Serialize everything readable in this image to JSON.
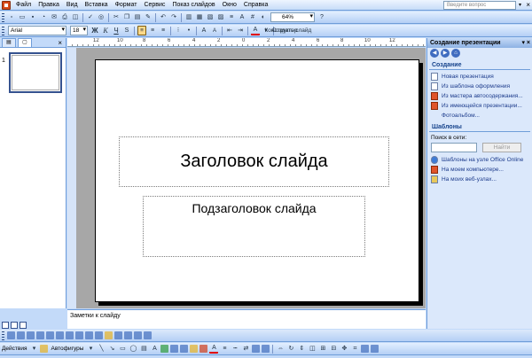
{
  "menu": {
    "items": [
      "Файл",
      "Правка",
      "Вид",
      "Вставка",
      "Формат",
      "Сервис",
      "Показ слайдов",
      "Окно",
      "Справка"
    ],
    "help_placeholder": "Введите вопрос",
    "close": "×"
  },
  "standard_toolbar": {
    "zoom": "64%"
  },
  "format_toolbar": {
    "font": "Arial",
    "size": "18",
    "bold": "Ж",
    "italic": "К",
    "underline": "Ч",
    "shadow": "S",
    "grow_font": "A",
    "shrink_font": "A",
    "font_color": "A",
    "designer": "Конструктор",
    "new_slide": "Создать слайд"
  },
  "left_pane": {
    "close": "×",
    "slide_number": "1"
  },
  "ruler": {
    "labels": [
      "12",
      "10",
      "8",
      "6",
      "4",
      "2",
      "0",
      "2",
      "4",
      "6",
      "8",
      "10",
      "12"
    ]
  },
  "slide": {
    "title": "Заголовок слайда",
    "subtitle": "Подзаголовок слайда"
  },
  "notes": {
    "placeholder": "Заметки к слайду"
  },
  "task_pane": {
    "title": "Создание презентации",
    "section_create": "Создание",
    "links_create": [
      {
        "label": "Новая презентация",
        "icon": "blank-doc-icon"
      },
      {
        "label": "Из шаблона оформления",
        "icon": "design-template-icon"
      },
      {
        "label": "Из мастера автосодержания...",
        "icon": "autocontent-wizard-icon"
      },
      {
        "label": "Из имеющейся презентации...",
        "icon": "existing-presentation-icon"
      }
    ],
    "photo_album": "Фотоальбом...",
    "section_templates": "Шаблоны",
    "search_label": "Поиск в сети:",
    "search_button": "Найти",
    "links_templates": [
      {
        "label": "Шаблоны на узле Office Online",
        "icon": "globe-icon"
      },
      {
        "label": "На моем компьютере...",
        "icon": "computer-icon"
      },
      {
        "label": "На моих веб-узлах...",
        "icon": "web-folder-icon"
      }
    ]
  },
  "draw_toolbar": {
    "actions": "Действия",
    "autoshapes": "Автофигуры"
  }
}
